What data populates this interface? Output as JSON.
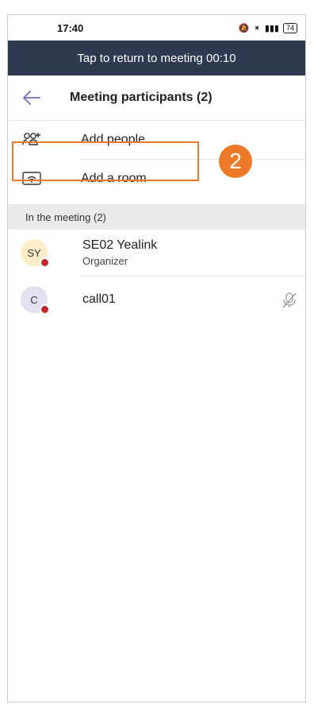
{
  "status_bar": {
    "time": "17:40",
    "battery": "74"
  },
  "banner": {
    "text": "Tap to return to meeting 00:10"
  },
  "header": {
    "title": "Meeting participants (2)"
  },
  "actions": [
    {
      "label": "Add people",
      "icon": "add-people-icon"
    },
    {
      "label": "Add a room",
      "icon": "room-icon"
    }
  ],
  "annotation": {
    "step": "2",
    "color": "#ec7a29"
  },
  "section": {
    "title": "In the meeting (2)"
  },
  "participants": [
    {
      "initials": "SY",
      "name": "SE02 Yealink",
      "role": "Organizer",
      "avatar_color": "#fcefc7"
    },
    {
      "initials": "C",
      "name": "call01",
      "role": "",
      "avatar_color": "#e3e1ef",
      "icon": "mic-off-icon"
    }
  ],
  "colors": {
    "banner_bg": "#2e3a50",
    "presence": "#c4262e"
  }
}
